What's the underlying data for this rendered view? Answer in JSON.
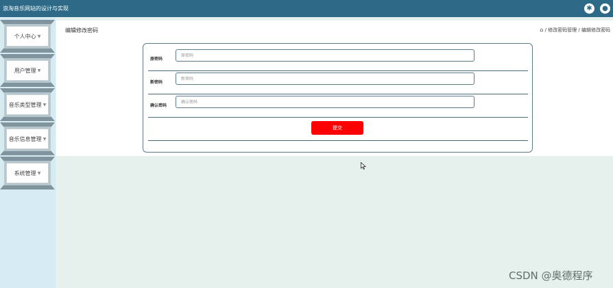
{
  "app": {
    "title": "浪淘音乐网站的设计与实现"
  },
  "topbar": {
    "icons": [
      "settings-icon",
      "user-icon"
    ]
  },
  "sidebar": {
    "items": [
      {
        "label": "个人中心"
      },
      {
        "label": "用户管理"
      },
      {
        "label": "音乐类型管理"
      },
      {
        "label": "音乐信息管理"
      },
      {
        "label": "系统管理"
      }
    ]
  },
  "main": {
    "page_title": "编辑修改密码",
    "breadcrumb": [
      "修改密码管理",
      "编辑修改密码"
    ],
    "breadcrumb_separator": "/"
  },
  "form": {
    "fields": [
      {
        "label": "原密码",
        "placeholder": "原密码",
        "value": ""
      },
      {
        "label": "新密码",
        "placeholder": "新密码",
        "value": ""
      },
      {
        "label": "确认密码",
        "placeholder": "确认密码",
        "value": ""
      }
    ],
    "submit_label": "提交"
  },
  "watermark": "CSDN @奥德程序",
  "colors": {
    "topbar": "#2d6a88",
    "sidebar": "#d7ecf2",
    "submit": "#ff0000",
    "content_bg": "#e6f0ec"
  }
}
